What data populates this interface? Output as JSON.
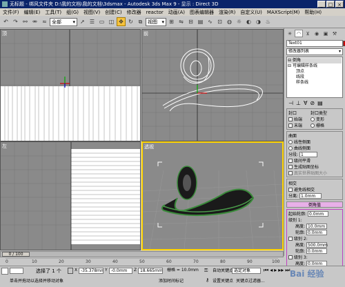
{
  "titlebar": {
    "title": "无标题 - 绑风文件夹 D:\\我的文档\\我的文档\\3dsmax - Autodesk 3ds Max 9 - 显示 : Direct 3D",
    "min": "_",
    "max": "□",
    "close": "×"
  },
  "menu": [
    "文件(F)",
    "编辑(E)",
    "工具(T)",
    "组(G)",
    "视图(V)",
    "创建(C)",
    "修改器",
    "reactor",
    "动画(A)",
    "图表编辑器",
    "渲染(R)",
    "自定义(U)",
    "MAXScript(M)",
    "帮助(H)"
  ],
  "toolbar": {
    "selection_filter": "全部",
    "coord_system": "视图",
    "icons": [
      "undo-icon",
      "redo-icon",
      "link-icon",
      "unlink-icon",
      "bind-icon",
      "select-icon",
      "select-name-icon",
      "rect-select-icon",
      "window-icon",
      "move-icon",
      "rotate-icon",
      "scale-icon",
      "pivot-icon",
      "mirror-icon",
      "align-icon",
      "layer-icon",
      "curve-icon",
      "schematic-icon",
      "material-icon",
      "render-setup-icon",
      "render-icon",
      "quick-render-icon"
    ]
  },
  "viewports": {
    "top_left": "顶",
    "top_right": "前",
    "bottom_left": "左",
    "bottom_right": "透视"
  },
  "command_panel": {
    "tab_icons": [
      "create-tab-icon",
      "modify-tab-icon",
      "hierarchy-tab-icon",
      "motion-tab-icon",
      "display-tab-icon",
      "utilities-tab-icon"
    ],
    "object_name": "Text01",
    "modifier_list": "修改器列表",
    "stack": [
      "倒角",
      "可编辑样条线",
      "顶点",
      "线段",
      "样条线"
    ],
    "rollout_params": {
      "capping_title": "封口",
      "cap_start": "始端",
      "cap_end": "末端",
      "cap_type_title": "封口类型",
      "morph": "变形",
      "grid": "栅格",
      "surface_title": "曲面",
      "linear_sides": "线性侧面",
      "curved_sides": "曲线侧面",
      "segments_label": "分段:",
      "segments_value": "1",
      "smooth_across": "级间平滑",
      "gen_mapping": "生成贴图坐标",
      "real_world": "真实世界贴图大小",
      "intersect_title": "相交",
      "avoid_intersect": "避免线相交",
      "separation_label": "分离:",
      "separation_value": "1.0mm"
    },
    "bevel_values": {
      "title": "倒角值",
      "start_outline_label": "起始轮廓:",
      "start_outline_value": "0.0mm",
      "level1": "级别 1:",
      "height1": "10.0mm",
      "outline1": "0.0mm",
      "level2": "级别 2:",
      "height2": "500.0mm",
      "outline2": "0.0mm",
      "level3": "级别 3:",
      "height3": "0.0mm",
      "outline3": "0.0mm",
      "height_label": "高度:",
      "outline_label": "轮廓:"
    }
  },
  "timeline": {
    "frame": "0 / 100",
    "ticks": [
      "0",
      "10",
      "20",
      "30",
      "40",
      "50",
      "60",
      "70",
      "80",
      "90",
      "100"
    ]
  },
  "status": {
    "selected": "选择了 1 个",
    "x": "-35.378mm",
    "y": "-0.0mm",
    "z": "18.665mm",
    "grid": "栅格 = 10.0mm",
    "auto_key": "自动关键点",
    "set_key": "设置关键点",
    "selected_obj": "选定对象",
    "key_filters": "关键点过滤器...",
    "hint": "单击并拖动以选择并移动对象",
    "add_time": "添加时间标记"
  },
  "watermark": "Bai 经验"
}
